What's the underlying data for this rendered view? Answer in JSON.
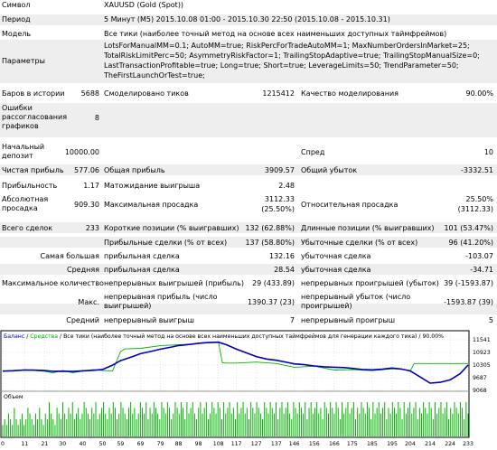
{
  "report": {
    "symbol": {
      "label": "Символ",
      "value": "XAUUSD (Gold (Spot))"
    },
    "period": {
      "label": "Период",
      "value": "5 Минут (M5) 2015.10.08 01:00 - 2015.10.30 22:50 (2015.10.08 - 2015.10.31)"
    },
    "model": {
      "label": "Модель",
      "value": "Все тики (наиболее точный метод на основе всех наименьших доступных таймфреймов)"
    },
    "parameters": {
      "label": "Параметры",
      "lines": [
        "LotsForManualMM=0.1; AutoMM=true; RiskPercForTradeAutoMM=1; MaxNumberOrdersInMarket=25;",
        "TotalRiskLimitPerc=50; AsymmetryRiskFactor=1; TrailingStopAdaptive=true; TrailingStopManualSize=0;",
        "LastTransactionProfitable=true; Long=true; Short=true; LeverageLimits=50; TrendParameter=50;",
        "TheFirstLaunchOrTest=true;"
      ]
    },
    "bars": {
      "label": "Баров в истории",
      "value": "5688"
    },
    "ticks": {
      "label": "Смоделировано тиков",
      "value": "1215412"
    },
    "quality": {
      "label": "Качество моделирования",
      "value": "90.00%"
    },
    "mismatch": {
      "label": "Ошибки рассогласования графиков",
      "value": "8"
    },
    "deposit": {
      "label": "Начальный депозит",
      "value": "10000.00"
    },
    "spread": {
      "label": "Спред",
      "value": "10"
    },
    "net_profit": {
      "label": "Чистая прибыль",
      "value": "577.06"
    },
    "gross_profit": {
      "label": "Общая прибыль",
      "value": "3909.57"
    },
    "gross_loss": {
      "label": "Общий убыток",
      "value": "-3332.51"
    },
    "profit_factor": {
      "label": "Прибыльность",
      "value": "1.17"
    },
    "expected_payoff": {
      "label": "Матожидание выигрыша",
      "value": "2.48"
    },
    "abs_drawdown": {
      "label": "Абсолютная просадка",
      "value": "909.30"
    },
    "max_drawdown": {
      "label": "Максимальная просадка",
      "value1": "3112.33",
      "value2": "(25.50%)"
    },
    "rel_drawdown": {
      "label": "Относительная просадка",
      "value1": "25.50%",
      "value2": "(3112.33)"
    },
    "total_trades": {
      "label": "Всего сделок",
      "value": "233"
    },
    "short_pos": {
      "label": "Короткие позиции (% выигравших)",
      "value": "132 (62.88%)"
    },
    "long_pos": {
      "label": "Длинные позиции (% выигравших)",
      "value": "101 (53.47%)"
    },
    "profit_trades": {
      "label": "Прибыльные сделки (% от всех)",
      "value": "137 (58.80%)"
    },
    "loss_trades": {
      "label": "Убыточные сделки (% от всех)",
      "value": "96 (41.20%)"
    },
    "largest": {
      "label": "Самая большая",
      "profit_label": "прибыльная сделка",
      "profit": "132.16",
      "loss_label": "убыточная сделка",
      "loss": "-103.07"
    },
    "average": {
      "label": "Средняя",
      "profit_label": "прибыльная сделка",
      "profit": "28.54",
      "loss_label": "убыточная сделка",
      "loss": "-34.71"
    },
    "max_count": {
      "label": "Максимальное количество",
      "wins_label": "непрерывных выигрышей (прибыль)",
      "wins": "29 (433.89)",
      "losses_label": "непрерывных проигрышей (убыток)",
      "losses": "39 (-1593.87)"
    },
    "max_amount": {
      "label": "Макс.",
      "profit_label": "непрерывная прибыль (число выигрышей)",
      "profit": "1390.37 (23)",
      "loss_label": "непрерывный убыток (число проигрышей)",
      "loss": "-1593.87 (39)"
    },
    "avg_cons": {
      "label": "Средний",
      "wins_label": "непрерывный выигрыш",
      "wins": "7",
      "losses_label": "непрерывный проигрыш",
      "losses": "5"
    }
  },
  "chart_data": {
    "type": "line",
    "header": {
      "balance": "Баланс",
      "sep": " / ",
      "equity": "Средства",
      "rest": " / Все тики (наиболее точный метод на основе всех наименьших доступных таймфреймов для генерации каждого тика) / 90.00%"
    },
    "volume_label": "Объем",
    "y_ticks": [
      11541,
      10923,
      10305,
      9687,
      9068
    ],
    "x_ticks": [
      0,
      11,
      21,
      30,
      40,
      50,
      59,
      69,
      79,
      88,
      98,
      108,
      117,
      127,
      137,
      146,
      156,
      166,
      175,
      185,
      195,
      204,
      214,
      224,
      233
    ],
    "ylim": [
      9068,
      11541
    ],
    "xlim": [
      0,
      233
    ],
    "colors": {
      "balance": "#0000b4",
      "equity": "#00b400",
      "volume": "#00b400",
      "grid": "#cccccc"
    },
    "series": [
      {
        "name": "Баланс",
        "x": [
          0,
          5,
          11,
          15,
          21,
          25,
          30,
          35,
          40,
          45,
          50,
          55,
          59,
          65,
          69,
          75,
          79,
          85,
          88,
          95,
          98,
          102,
          108,
          112,
          117,
          122,
          127,
          132,
          137,
          142,
          146,
          151,
          156,
          161,
          166,
          171,
          175,
          180,
          185,
          190,
          195,
          200,
          204,
          209,
          214,
          219,
          224,
          229,
          233
        ],
        "y": [
          10010,
          10025,
          10060,
          10055,
          10035,
          10000,
          10005,
          9990,
          10020,
          10050,
          10090,
          10300,
          10520,
          10720,
          10860,
          10990,
          11080,
          11190,
          11260,
          11330,
          11370,
          11400,
          11420,
          11300,
          11080,
          10900,
          10720,
          10600,
          10540,
          10440,
          10360,
          10320,
          10260,
          10220,
          10200,
          10180,
          10140,
          10090,
          10070,
          10100,
          10160,
          10100,
          10020,
          9720,
          9420,
          9460,
          9580,
          9880,
          10305
        ]
      },
      {
        "name": "Средства",
        "x": [
          0,
          5,
          11,
          15,
          21,
          25,
          30,
          35,
          40,
          45,
          50,
          55,
          59,
          61,
          69,
          79,
          88,
          95,
          98,
          105,
          108,
          110,
          112,
          117,
          127,
          137,
          146,
          156,
          166,
          175,
          185,
          195,
          200,
          204,
          206,
          214,
          224,
          233
        ],
        "y": [
          10010,
          10030,
          10080,
          10050,
          10000,
          9920,
          10040,
          9930,
          10010,
          10080,
          10040,
          10020,
          10960,
          11090,
          11120,
          11250,
          11300,
          11320,
          11380,
          11420,
          11440,
          10420,
          10400,
          10400,
          10450,
          10380,
          10200,
          10250,
          10060,
          10080,
          10030,
          10120,
          10100,
          10000,
          10380,
          10380,
          10380,
          10380
        ]
      }
    ],
    "volume": [
      2,
      3,
      2,
      4,
      3,
      2,
      5,
      3,
      2,
      3,
      4,
      2,
      3,
      5,
      4,
      3,
      2,
      4,
      3,
      5,
      3,
      2,
      4,
      3,
      6,
      4,
      3,
      2,
      5,
      4,
      3,
      6,
      4,
      3,
      5,
      4,
      6,
      3,
      4,
      5,
      3,
      4,
      6,
      5,
      4,
      3,
      5,
      4,
      6,
      3,
      4,
      5,
      6,
      4,
      3,
      5,
      4,
      6,
      5,
      3,
      4,
      6,
      5,
      4,
      3,
      5,
      6,
      4,
      5,
      3,
      4,
      6,
      5,
      4,
      6,
      3,
      5,
      4,
      6,
      5,
      4,
      3,
      6,
      5,
      4,
      6,
      5,
      3,
      4,
      6,
      5,
      4,
      6,
      5,
      3,
      6,
      4,
      5,
      6,
      4,
      3,
      5,
      6,
      4,
      5,
      6,
      3,
      4,
      6,
      5,
      4,
      6,
      5,
      3,
      6,
      4,
      5,
      6,
      4,
      5,
      3,
      6,
      4,
      5,
      6,
      4,
      5,
      3,
      6,
      5,
      4,
      6,
      5,
      4,
      3,
      6,
      5,
      4,
      6,
      5,
      4,
      6,
      3,
      5,
      6,
      4,
      5,
      6,
      4,
      3,
      6,
      5,
      4,
      6,
      5,
      4,
      6,
      3,
      5,
      6,
      4,
      5,
      6,
      4,
      5,
      3,
      6,
      5,
      4,
      6,
      5,
      4,
      6,
      5,
      3,
      6,
      4,
      5,
      6,
      4,
      5,
      6,
      3,
      5,
      4,
      6,
      5,
      4,
      6,
      5,
      3,
      6,
      4,
      5,
      6,
      4,
      5,
      6,
      3,
      5,
      4,
      6,
      5,
      4,
      6,
      5,
      3,
      6,
      4,
      5,
      6,
      4,
      5,
      6,
      3,
      5,
      4,
      6,
      5,
      4,
      6,
      5,
      3,
      6,
      4,
      5,
      6,
      4,
      5,
      6,
      3,
      5,
      4,
      6,
      5,
      4,
      6,
      5,
      3,
      6,
      4
    ]
  }
}
